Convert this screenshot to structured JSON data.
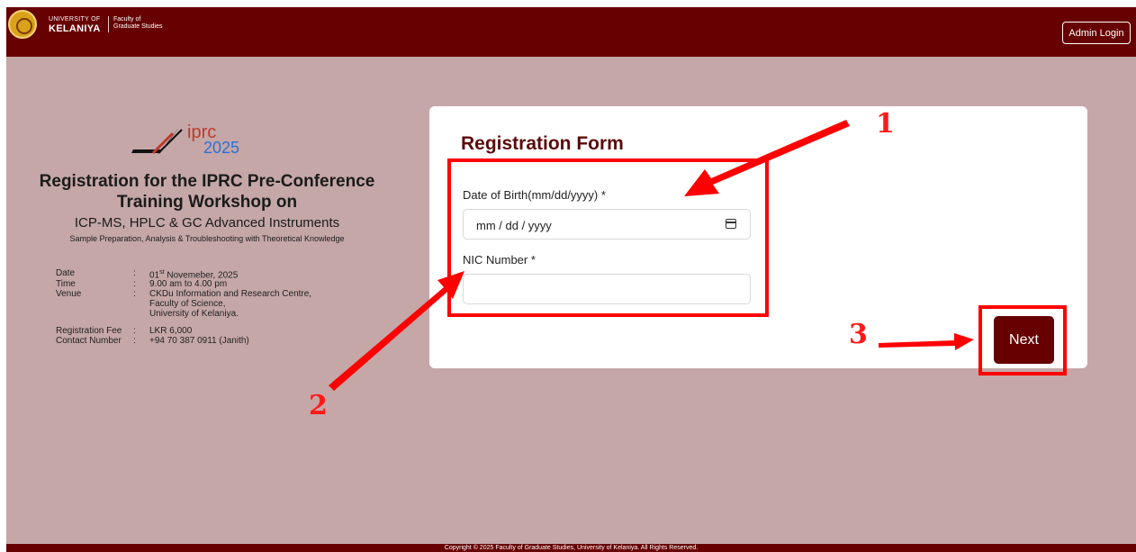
{
  "header": {
    "university_small": "UNIVERSITY OF",
    "university_name": "KELANIYA",
    "faculty_line1": "Faculty of",
    "faculty_line2": "Graduate Studies",
    "admin_login": "Admin Login"
  },
  "event": {
    "logo_text_a": "iprc",
    "logo_text_b": "2025",
    "title": "Registration for the IPRC Pre-Conference Training Workshop on",
    "subtitle": "ICP-MS, HPLC & GC Advanced Instruments",
    "subtitle2": "Sample Preparation, Analysis & Troubleshooting with Theoretical Knowledge",
    "details": [
      {
        "label": "Date",
        "value_pre": "01",
        "value_sup": "st",
        "value_post": " Novemeber, 2025"
      },
      {
        "label": "Time",
        "value": "9.00 am to 4.00 pm"
      },
      {
        "label": "Venue",
        "value_l1": "CKDu Information and Research Centre,",
        "value_l2": "Faculty of Science,",
        "value_l3": "University of Kelaniya."
      },
      {
        "label": "Registration Fee",
        "value": "LKR 6,000"
      },
      {
        "label": "Contact Number",
        "value": "+94 70 387 0911 (Janith)"
      }
    ],
    "colon": ":"
  },
  "form": {
    "title": "Registration Form",
    "dob_label": "Date of Birth(mm/dd/yyyy) *",
    "dob_placeholder": "mm / dd / yyyy",
    "nic_label": "NIC Number *",
    "nic_value": "",
    "next_button": "Next"
  },
  "annotations": {
    "step1": "1",
    "step2": "2",
    "step3": "3",
    "color": "#ff0000"
  },
  "footer": {
    "text": "Copyright © 2025 Faculty of Graduate Studies, University of Kelaniya. All Rights Reserved."
  },
  "colors": {
    "brand": "#670000",
    "background": "#c5a7a7",
    "card": "#ffffff"
  },
  "icons": [
    "university-seal-icon",
    "iprc-logo-icon",
    "calendar-icon",
    "arrow-icon"
  ]
}
